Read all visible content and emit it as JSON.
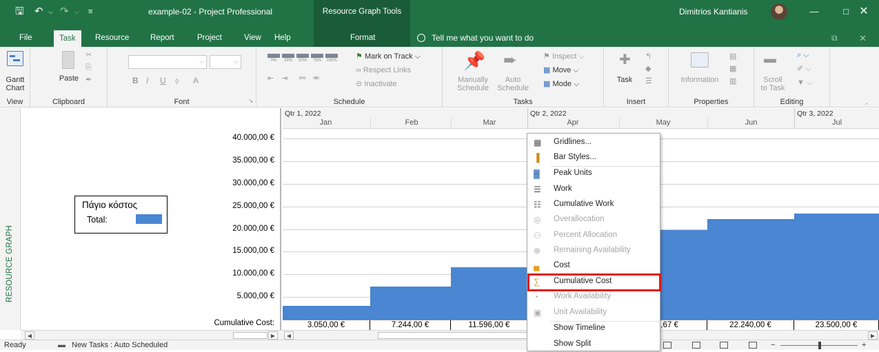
{
  "titlebar": {
    "title": "example-02  -  Project Professional",
    "context_band": "Resource Graph Tools",
    "user": "Dimitrios Kantianis",
    "save_icon": "save-icon",
    "undo_icon": "undo-icon",
    "redo_icon": "redo-icon"
  },
  "tabs": {
    "file": "File",
    "task": "Task",
    "resource": "Resource",
    "report": "Report",
    "project": "Project",
    "view": "View",
    "help": "Help",
    "format": "Format",
    "tell_me": "Tell me what you want to do"
  },
  "ribbon": {
    "view": {
      "gantt": "Gantt",
      "chart": "Chart",
      "label": "View"
    },
    "clipboard": {
      "paste": "Paste",
      "label": "Clipboard"
    },
    "font": {
      "bold": "B",
      "italic": "I",
      "underline": "U",
      "color_a": "A",
      "label": "Font"
    },
    "schedule": {
      "pct": [
        "0%",
        "25%",
        "50%",
        "75%",
        "100%"
      ],
      "mark_on_track": "Mark on Track",
      "respect_links": "Respect Links",
      "inactivate": "Inactivate",
      "label": "Schedule"
    },
    "tasks": {
      "manually": "Manually",
      "schedule1": "Schedule",
      "auto": "Auto",
      "schedule2": "Schedule",
      "inspect": "Inspect",
      "move": "Move",
      "mode": "Mode",
      "label": "Tasks"
    },
    "insert": {
      "task": "Task",
      "label": "Insert"
    },
    "properties": {
      "information": "Information",
      "label": "Properties"
    },
    "editing": {
      "scroll": "Scroll",
      "to_task": "to Task",
      "label": "Editing"
    }
  },
  "side_label": "RESOURCE GRAPH",
  "legend": {
    "name": "Πάγιο κόστος",
    "total": "Total:",
    "swatch_color": "#4a86d2"
  },
  "timescale": {
    "quarters": [
      "Qtr 1, 2022",
      "Qtr 2, 2022",
      "Qtr 3, 2022"
    ],
    "months": [
      "Jan",
      "Feb",
      "Mar",
      "Apr",
      "May",
      "Jun",
      "Jul"
    ]
  },
  "chart_data": {
    "type": "area",
    "title": "",
    "xlabel": "",
    "ylabel": "",
    "series": [
      {
        "name": "Πάγιο κόστος",
        "color": "#4a86d2",
        "categories": [
          "Jan",
          "Feb",
          "Mar",
          "Apr",
          "May",
          "Jun",
          "Jul"
        ],
        "values": [
          3050,
          7244,
          11596,
          19500,
          19836.67,
          22240,
          23500
        ]
      }
    ],
    "y_ticks": [
      "40.000,00 €",
      "35.000,00 €",
      "30.000,00 €",
      "25.000,00 €",
      "20.000,00 €",
      "15.000,00 €",
      "10.000,00 €",
      "5.000,00 €"
    ],
    "ylim": [
      0,
      42000
    ],
    "grid": true
  },
  "cumulative": {
    "label": "Cumulative Cost:",
    "values": [
      "3.050,00 €",
      "7.244,00 €",
      "11.596,00 €",
      "836,67 €",
      "22.240,00 €",
      "23.500,00 €"
    ]
  },
  "context_menu": {
    "items": [
      {
        "label": "Gridlines...",
        "icon": "gridlines-icon",
        "enabled": true
      },
      {
        "label": "Bar Styles...",
        "icon": "bar-styles-icon",
        "enabled": true
      },
      {
        "label": "Peak Units",
        "icon": "peak-units-icon",
        "enabled": true
      },
      {
        "label": "Work",
        "icon": "work-icon",
        "enabled": true
      },
      {
        "label": "Cumulative Work",
        "icon": "cumulative-work-icon",
        "enabled": true
      },
      {
        "label": "Overallocation",
        "icon": "overallocation-icon",
        "enabled": false
      },
      {
        "label": "Percent Allocation",
        "icon": "percent-allocation-icon",
        "enabled": false
      },
      {
        "label": "Remaining Availability",
        "icon": "remaining-availability-icon",
        "enabled": false
      },
      {
        "label": "Cost",
        "icon": "cost-icon",
        "enabled": true
      },
      {
        "label": "Cumulative Cost",
        "icon": "cumulative-cost-icon",
        "enabled": true
      },
      {
        "label": "Work Availability",
        "icon": "work-availability-icon",
        "enabled": false
      },
      {
        "label": "Unit Availability",
        "icon": "unit-availability-icon",
        "enabled": false
      },
      {
        "label": "Show Timeline",
        "icon": "",
        "enabled": true
      },
      {
        "label": "Show Split",
        "icon": "",
        "enabled": true
      }
    ],
    "highlight_color": "#e0161b"
  },
  "status": {
    "ready": "Ready",
    "new_tasks": "New Tasks : Auto Scheduled"
  },
  "colors": {
    "accent": "#217346",
    "bar": "#4a86d2"
  }
}
